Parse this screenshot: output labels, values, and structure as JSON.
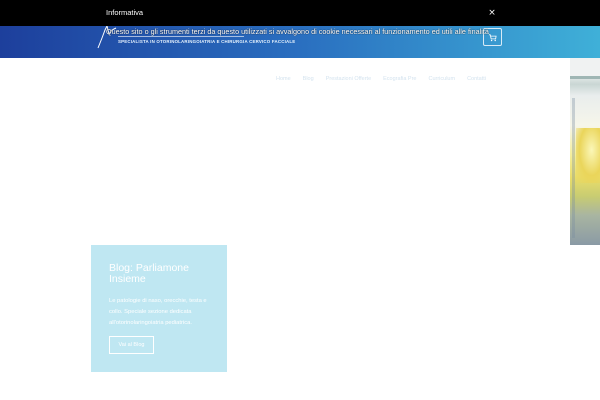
{
  "cookie_banner": {
    "title": "Informativa",
    "text": "Questo sito o gli strumenti terzi da questo utilizzati si avvalgono di cookie necessari al funzionamento ed utili alle finalità",
    "close_symbol": "×",
    "close_icon": "close-icon"
  },
  "header": {
    "logo_subtitle": "SPECIALISTA IN OTORINOLARINGOIATRIA E CHIRURGIA CERVICO FACCIALE",
    "cart_icon": "cart-icon",
    "gradient_colors": [
      "#1d3f9c",
      "#3fb0d8"
    ]
  },
  "nav": {
    "items": [
      {
        "label": "Home"
      },
      {
        "label": "Blog"
      },
      {
        "label": "Prestazioni Offerte"
      },
      {
        "label": "Ecografia Pre"
      },
      {
        "label": "Curriculum"
      },
      {
        "label": "Contatti"
      }
    ]
  },
  "blog_card": {
    "title": "Blog: Parliamone Insieme",
    "description": "Le patologie di naso, orecchie, testa e collo. Speciale sezione dedicata all'otorinolaringoiatria pediatrica.",
    "button_label": "Vai al Blog",
    "background": "#bfe7f2"
  }
}
